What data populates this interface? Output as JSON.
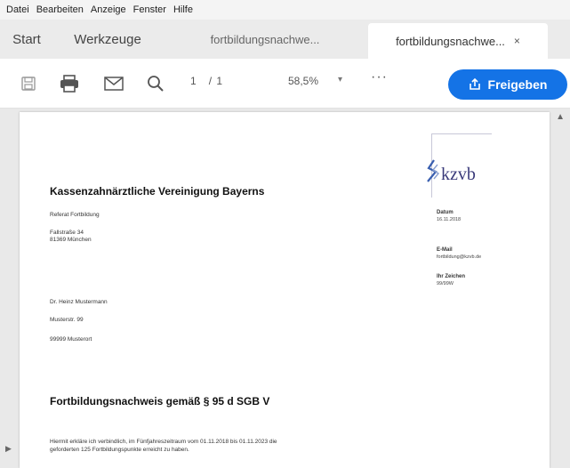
{
  "menu": [
    "Datei",
    "Bearbeiten",
    "Anzeige",
    "Fenster",
    "Hilfe"
  ],
  "tabs": {
    "start": "Start",
    "tools": "Werkzeuge",
    "doc1": "fortbildungsnachwe...",
    "doc2": "fortbildungsnachwe...",
    "close": "×"
  },
  "toolbar": {
    "page_current": "1",
    "page_total": "/ 1",
    "zoom": "58,5%",
    "zoom_caret": "▾",
    "more": "···",
    "share_label": "Freigeben"
  },
  "document": {
    "logo_text": "kzvb",
    "org_name": "Kassenzahnärztliche Vereinigung Bayerns",
    "referat": "Referat Fortbildung",
    "street": "Fallstraße 34",
    "city": "81369 München",
    "recipient_name": "Dr. Heinz Mustermann",
    "recipient_street": "Musterstr. 99",
    "recipient_city": "99999 Musterort",
    "datum_label": "Datum",
    "datum_value": "16.11.2018",
    "email_label": "E-Mail",
    "email_value": "fortbildung@kzvb.de",
    "az_label": "Ihr Zeichen",
    "az_value": "99/99W",
    "heading": "Fortbildungsnachweis gemäß § 95 d SGB V",
    "body_line1": "Hiermit erkläre ich verbindlich, im Fünfjahreszeitraum vom 01.11.2018 bis 01.11.2023 die",
    "body_line2": "geforderten 125 Fortbildungspunkte erreicht zu haben."
  },
  "colors": {
    "accent": "#1473e6",
    "tab_bg": "#ebebeb",
    "doc_bg": "#e9e9e9"
  }
}
